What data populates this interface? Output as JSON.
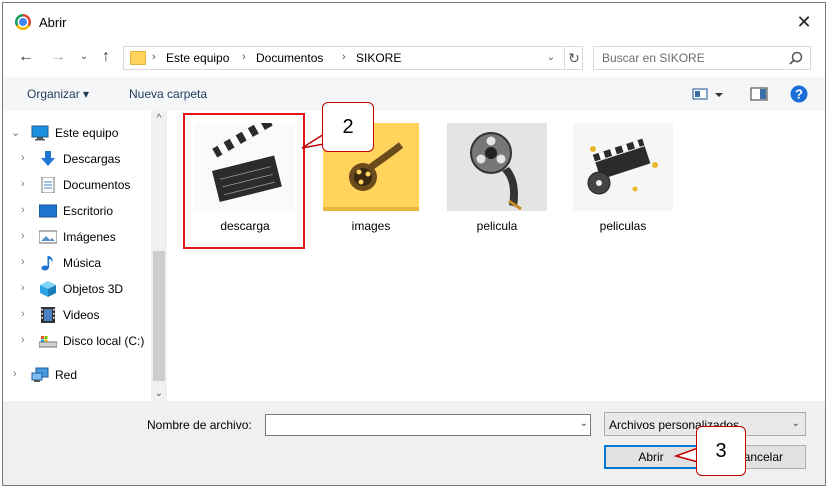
{
  "window": {
    "title": "Abrir"
  },
  "address": {
    "crumbs": [
      "Este equipo",
      "Documentos",
      "SIKORE"
    ]
  },
  "search": {
    "placeholder": "Buscar en SIKORE"
  },
  "toolbar": {
    "organize": "Organizar ▾",
    "new_folder": "Nueva carpeta"
  },
  "sidebar": {
    "items": [
      {
        "label": "Este equipo",
        "icon": "computer-icon"
      },
      {
        "label": "Descargas",
        "icon": "download-icon"
      },
      {
        "label": "Documentos",
        "icon": "document-icon"
      },
      {
        "label": "Escritorio",
        "icon": "desktop-icon"
      },
      {
        "label": "Imágenes",
        "icon": "pictures-icon"
      },
      {
        "label": "Música",
        "icon": "music-icon"
      },
      {
        "label": "Objetos 3D",
        "icon": "cube-icon"
      },
      {
        "label": "Videos",
        "icon": "video-icon"
      },
      {
        "label": "Disco local (C:)",
        "icon": "drive-icon"
      },
      {
        "label": "Red",
        "icon": "network-icon"
      }
    ]
  },
  "files": [
    {
      "name": "descarga",
      "kind": "clapperboard-image"
    },
    {
      "name": "images",
      "kind": "film-reel-folder"
    },
    {
      "name": "pelicula",
      "kind": "film-reel-image"
    },
    {
      "name": "peliculas",
      "kind": "clapper-reel-image"
    }
  ],
  "callouts": {
    "step2": "2",
    "step3": "3"
  },
  "footer": {
    "filename_label": "Nombre de archivo:",
    "filename_value": "",
    "filter_value": "Archivos personalizados",
    "open_label": "Abrir",
    "cancel_label": "Cancelar"
  },
  "colors": {
    "highlight": "#e01818",
    "accent": "#0078d7",
    "help": "#1a6fd6"
  }
}
